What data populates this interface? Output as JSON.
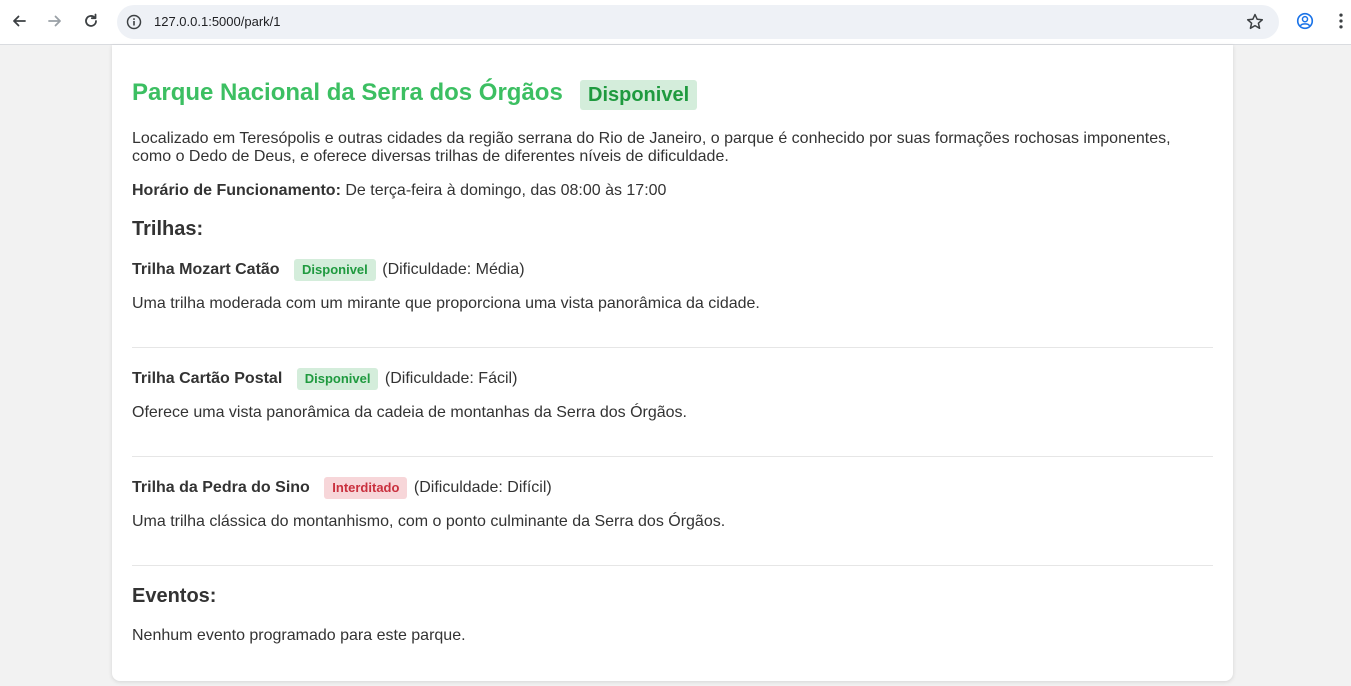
{
  "browser": {
    "url": "127.0.0.1:5000/park/1"
  },
  "park": {
    "title": "Parque Nacional da Serra dos Órgãos",
    "status": "Disponivel",
    "description": "Localizado em Teresópolis e outras cidades da região serrana do Rio de Janeiro, o parque é conhecido por suas formações rochosas imponentes, como o Dedo de Deus, e oferece diversas trilhas de diferentes níveis de dificuldade.",
    "hours_label": "Horário de Funcionamento:",
    "hours_value": "De terça-feira à domingo, das 08:00 às 17:00"
  },
  "trails_heading": "Trilhas:",
  "trails": [
    {
      "name": "Trilha Mozart Catão",
      "status": "Disponivel",
      "difficulty": "(Dificuldade: Média)",
      "description": "Uma trilha moderada com um mirante que proporciona uma vista panorâmica da cidade."
    },
    {
      "name": "Trilha Cartão Postal",
      "status": "Disponivel",
      "difficulty": "(Dificuldade: Fácil)",
      "description": "Oferece uma vista panorâmica da cadeia de montanhas da Serra dos Órgãos."
    },
    {
      "name": "Trilha da Pedra do Sino",
      "status": "Interditado",
      "difficulty": "(Dificuldade: Difícil)",
      "description": "Uma trilha clássica do montanhismo, com o ponto culminante da Serra dos Órgãos."
    }
  ],
  "events_heading": "Eventos:",
  "events_empty": "Nenhum evento programado para este parque.",
  "colors": {
    "title_green": "#3cbf62",
    "badge_ok_bg": "#d4eddb",
    "badge_ok_text": "#1f9a3f",
    "badge_bad_bg": "#f7d6d9",
    "badge_bad_text": "#c9303e"
  }
}
